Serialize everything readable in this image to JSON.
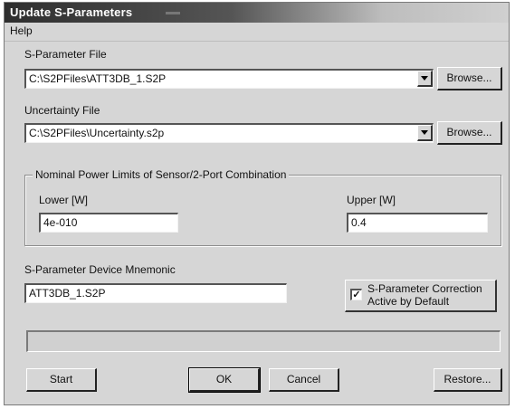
{
  "window": {
    "title": "Update S-Parameters"
  },
  "menu": {
    "help": "Help"
  },
  "sparam_file": {
    "label": "S-Parameter File",
    "value": "C:\\S2PFiles\\ATT3DB_1.S2P",
    "browse": "Browse..."
  },
  "uncertainty_file": {
    "label": "Uncertainty File",
    "value": "C:\\S2PFiles\\Uncertainty.s2p",
    "browse": "Browse..."
  },
  "limits": {
    "group_title": "Nominal Power Limits of Sensor/2-Port Combination",
    "lower_label": "Lower [W]",
    "lower_value": "4e-010",
    "upper_label": "Upper [W]",
    "upper_value": "0.4"
  },
  "mnemonic": {
    "label": "S-Parameter Device Mnemonic",
    "value": "ATT3DB_1.S2P"
  },
  "correction": {
    "checked": true,
    "line1": "S-Parameter Correction",
    "line2": "Active by Default"
  },
  "progress": {
    "value": 0
  },
  "buttons": {
    "start": "Start",
    "ok": "OK",
    "cancel": "Cancel",
    "restore": "Restore..."
  }
}
